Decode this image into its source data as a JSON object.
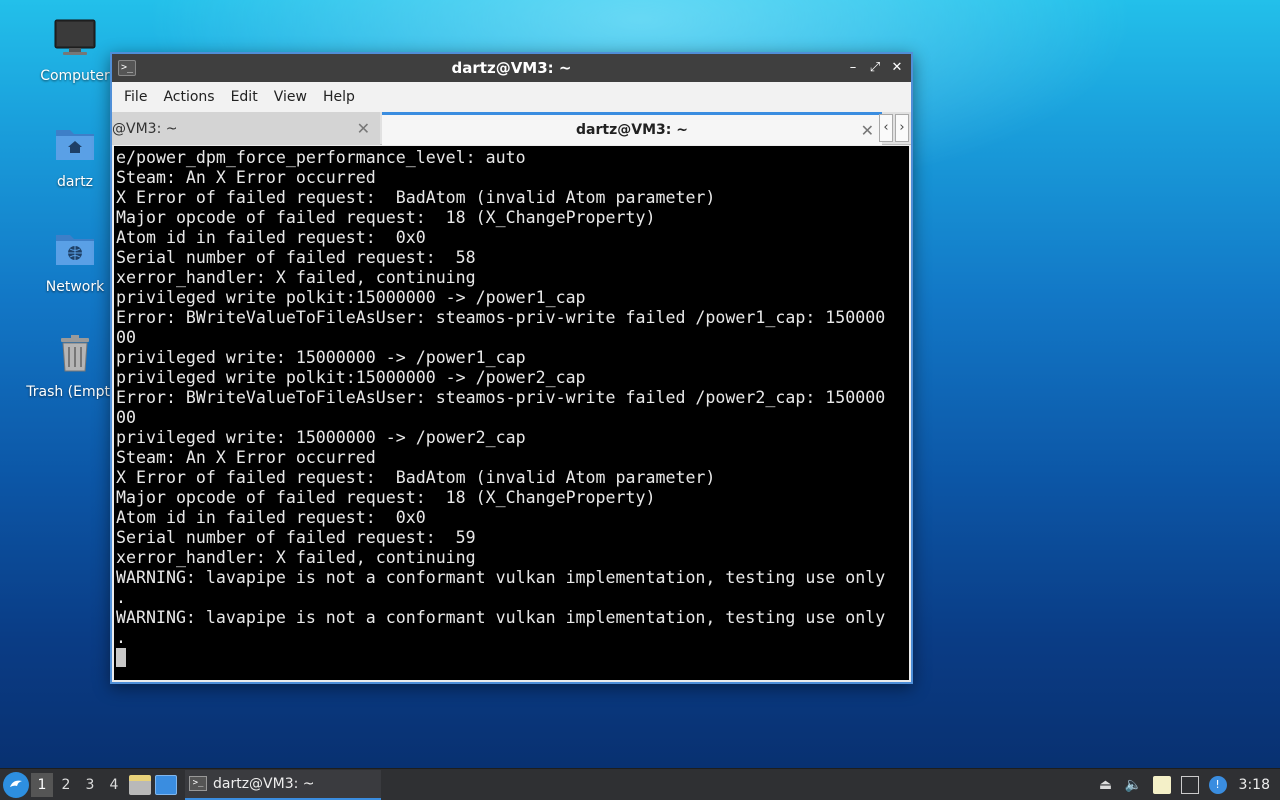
{
  "desktop": {
    "icons": [
      {
        "label": "Computer",
        "icon": "monitor-icon"
      },
      {
        "label": "dartz",
        "icon": "home-folder-icon"
      },
      {
        "label": "Network",
        "icon": "network-folder-icon"
      },
      {
        "label": "Trash (Empty)",
        "icon": "trash-icon"
      }
    ]
  },
  "window": {
    "title": "dartz@VM3: ~",
    "controls": {
      "minimize": "–",
      "maximize": "⤢",
      "close": "✕"
    },
    "menu": [
      "File",
      "Actions",
      "Edit",
      "View",
      "Help"
    ],
    "tabs": [
      {
        "label": "@VM3: ~",
        "active": false
      },
      {
        "label": "dartz@VM3: ~",
        "active": true
      }
    ],
    "tab_close": "✕",
    "scroll_left": "‹",
    "scroll_right": "›"
  },
  "terminal": {
    "lines": [
      "e/power_dpm_force_performance_level: auto",
      "Steam: An X Error occurred",
      "X Error of failed request:  BadAtom (invalid Atom parameter)",
      "Major opcode of failed request:  18 (X_ChangeProperty)",
      "Atom id in failed request:  0x0",
      "Serial number of failed request:  58",
      "xerror_handler: X failed, continuing",
      "privileged write polkit:15000000 -> /power1_cap",
      "Error: BWriteValueToFileAsUser: steamos-priv-write failed /power1_cap: 150000",
      "00",
      "privileged write: 15000000 -> /power1_cap",
      "privileged write polkit:15000000 -> /power2_cap",
      "Error: BWriteValueToFileAsUser: steamos-priv-write failed /power2_cap: 150000",
      "00",
      "privileged write: 15000000 -> /power2_cap",
      "Steam: An X Error occurred",
      "X Error of failed request:  BadAtom (invalid Atom parameter)",
      "Major opcode of failed request:  18 (X_ChangeProperty)",
      "Atom id in failed request:  0x0",
      "Serial number of failed request:  59",
      "xerror_handler: X failed, continuing",
      "WARNING: lavapipe is not a conformant vulkan implementation, testing use only",
      ".",
      "WARNING: lavapipe is not a conformant vulkan implementation, testing use only",
      "."
    ]
  },
  "taskbar": {
    "workspaces": [
      "1",
      "2",
      "3",
      "4"
    ],
    "active_workspace": "1",
    "task_label": "dartz@VM3: ~",
    "clock": "3:18"
  },
  "colors": {
    "accent": "#3a8de0",
    "terminal_bg": "#000000",
    "terminal_fg": "#e8e8e8"
  }
}
